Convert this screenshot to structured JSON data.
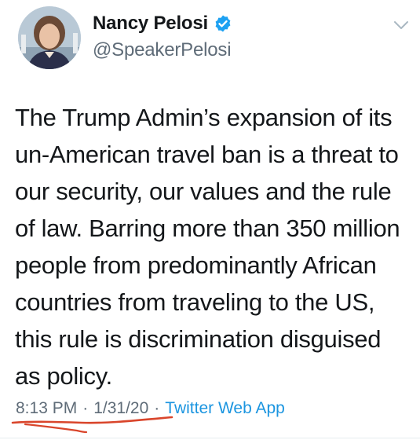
{
  "tweet": {
    "display_name": "Nancy Pelosi",
    "handle": "@SpeakerPelosi",
    "verified": true,
    "text": "The Trump Admin’s expansion of its un-American travel ban is a threat to our security, our values and the rule of law. Barring more than 350 million people from predominantly African countries from traveling to the US, this rule is discrimination disguised as policy.",
    "time": "8:13 PM",
    "date": "1/31/20",
    "separator": "·",
    "source": "Twitter Web App"
  },
  "icons": {
    "verified": "verified-badge-icon",
    "menu": "chevron-down-icon"
  },
  "colors": {
    "text": "#14171a",
    "secondary": "#5f6c78",
    "link": "#1b95e0",
    "verified": "#1da1f2",
    "annotation": "#d9452b"
  }
}
